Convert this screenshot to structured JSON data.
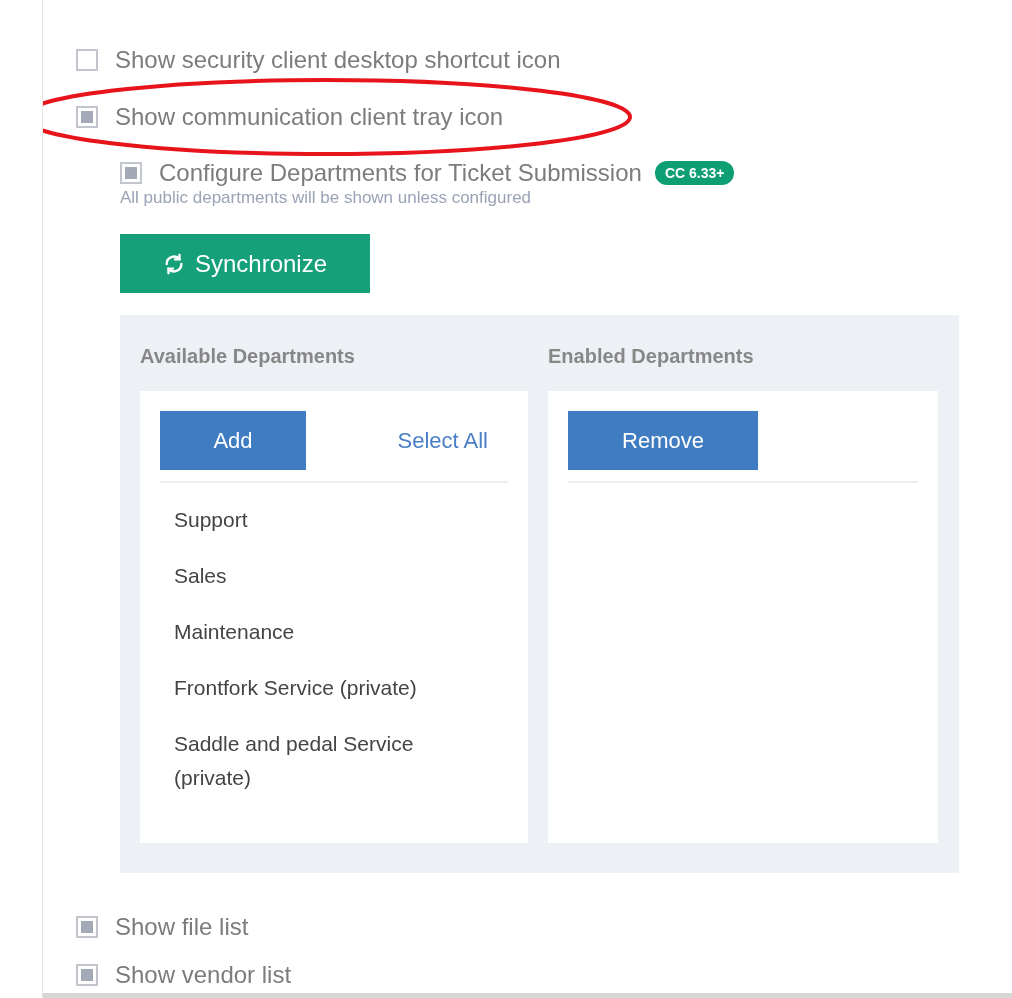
{
  "options": [
    {
      "label": "Show security client desktop shortcut icon",
      "checked": false,
      "highlighted": false
    },
    {
      "label": "Show communication client tray icon",
      "checked": true,
      "highlighted": true
    }
  ],
  "departments_config": {
    "label": "Configure Departments for Ticket Submission",
    "checked": true,
    "badge": "CC 6.33+",
    "hint": "All public departments will be shown unless configured",
    "sync_button": "Synchronize",
    "available": {
      "title": "Available Departments",
      "add_button": "Add",
      "select_all": "Select All",
      "items": [
        "Support",
        "Sales",
        "Maintenance",
        "Frontfork Service (private)",
        "Saddle and pedal Service (private)"
      ]
    },
    "enabled": {
      "title": "Enabled Departments",
      "remove_button": "Remove"
    }
  },
  "more_options": [
    {
      "label": "Show file list",
      "checked": true
    },
    {
      "label": "Show vendor list",
      "checked": true
    }
  ]
}
